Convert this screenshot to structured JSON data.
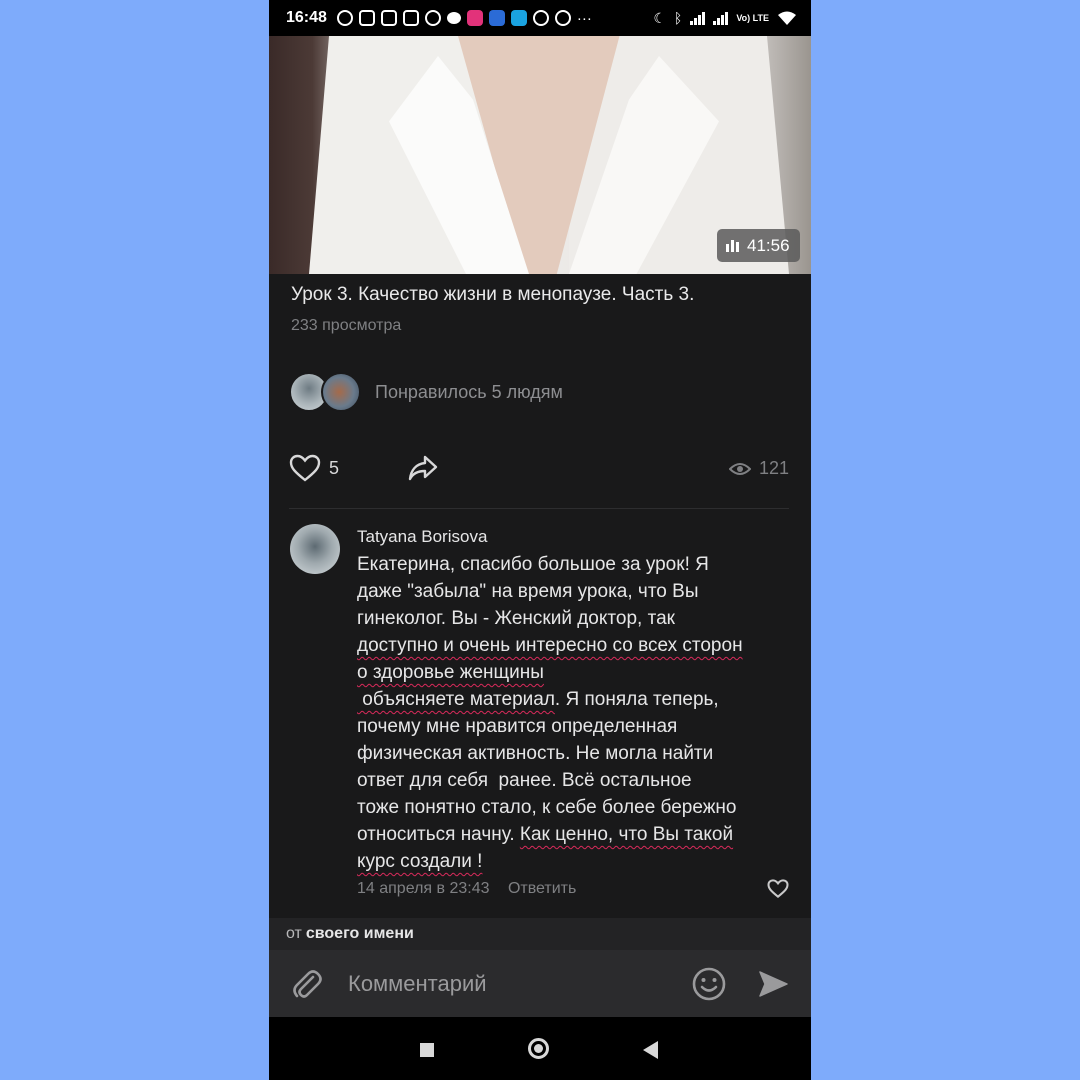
{
  "status_bar": {
    "time": "16:48",
    "network": "Vo) LTE"
  },
  "video": {
    "duration": "41:56",
    "title": "Урок 3. Качество жизни в менопаузе. Часть 3.",
    "views": "233 просмотра"
  },
  "likes_summary": {
    "text": "Понравилось 5 людям"
  },
  "actions": {
    "like_count": "5",
    "view_count": "121"
  },
  "comment": {
    "author": "Tatyana Borisova",
    "lines": [
      "Екатерина, спасибо большое за урок! Я",
      "даже \"забыла\" на время урока, что Вы",
      "гинеколог. Вы - Женский доктор, так",
      "доступно и очень интересно со всех сторон",
      "о здоровье женщины",
      " объясняете материал",
      ". Я поняла теперь,",
      "почему мне нравится определенная",
      "физическая активность. Не могла найти",
      "ответ для себя  ранее. Всё остальное",
      "тоже понятно стало, к себе более бережно",
      "относиться начну. ",
      "Как ценно, что Вы такой",
      "курс создали !"
    ],
    "date": "14 апреля в 23:43",
    "reply_label": "Ответить"
  },
  "post_as": {
    "prefix": "от",
    "value": "своего имени"
  },
  "input": {
    "placeholder": "Комментарий"
  }
}
